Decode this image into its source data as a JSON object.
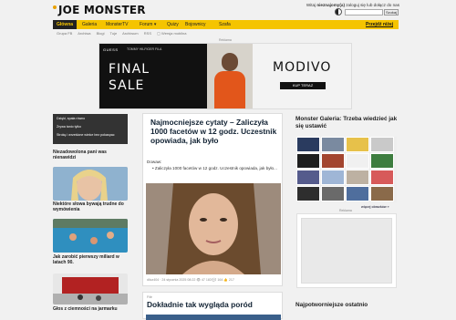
{
  "header": {
    "logo": "JOE MONSTER",
    "login_prefix": "Witaj ",
    "login_user": "nieznajomy(a)",
    "login_suffix": " zaloguj się lub dołącz do nas",
    "search_button": "Szukaj"
  },
  "nav": {
    "items": [
      "Główna",
      "Galeria",
      "MonsterTV",
      "Forum ▾",
      "Quizy",
      "Bojownicy",
      "Szafa"
    ],
    "active_index": 0,
    "right": "Przejdź niżej",
    "accent": "#f5c400"
  },
  "subnav": [
    "Grupa FB",
    "Archiwa",
    "Blogi",
    "Tuje",
    "Archiwum",
    "RSS",
    "▢ Wersja mobilna"
  ],
  "ads": {
    "label": "Reklama",
    "banner": {
      "brand_left": "GUESS",
      "brands_small": "TOMMY HILFIGER   FILA",
      "line1": "FINAL",
      "line2": "SALE",
      "brand_right": "MODIVO",
      "cta": "KUP TERAZ"
    }
  },
  "left_column": {
    "dark_box": [
      "Dzięki, spała równo",
      "Zrywa tanio tylko",
      "Strokę i wrześlone wielce bez pokaspac"
    ],
    "items": [
      {
        "title": "Niezadowolona pani was nienawidzi"
      },
      {
        "title": "Niektóre słowa bywają trudne do wymówienia"
      },
      {
        "title": "Jak zarobić pierwszy miliard w latach 90."
      },
      {
        "title": "Głos z ciemności na jarmarku"
      }
    ]
  },
  "main": {
    "title": "Najmocniejsze cytaty – Zaliczyła 1000 facetów w 12 godz. Uczestnik opowiada, jak było",
    "lead": "Dowaw:",
    "bullet": "Zaliczyła 1000 facetów w 12 godz. Uczestnik opowiada, jak było...",
    "meta": "dlicz404 · 24 stycznia 2025 08:22    👁 47 183    💬 164    👍 217",
    "second_tag": "Filtr",
    "second_title": "Dokładnie tak wygląda poród"
  },
  "right_column": {
    "gallery_title": "Monster Galeria: Trzeba wiedzieć jak się ustawić",
    "gallery_link": "więcej obrazków »",
    "ad_label": "Reklama",
    "bottom_title": "Najpotworniejsze ostatnio"
  }
}
